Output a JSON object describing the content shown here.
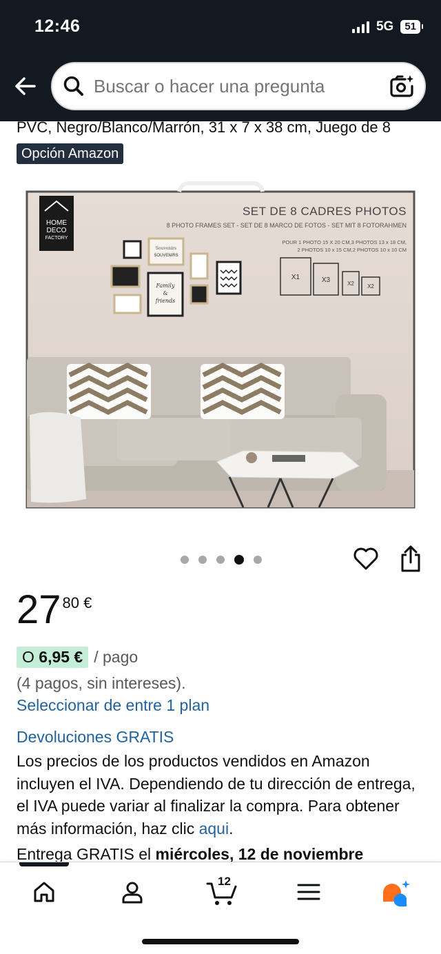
{
  "status_bar": {
    "time": "12:46",
    "network": "5G",
    "battery": "51"
  },
  "search": {
    "placeholder": "Buscar o hacer una pregunta"
  },
  "product": {
    "title_tail": "PVC, Negro/Blanco/Marrón, 31 x 7 x 38 cm, Juego de 8",
    "choice_badge": "Opción Amazon",
    "image": {
      "brand_lines": [
        "HOME",
        "DECO",
        "FACTORY"
      ],
      "headline": "SET DE 8 CADRES PHOTOS",
      "subtitle": "8 PHOTO FRAMES SET - SET DE 8 MARCO DE FOTOS - SET MIT 8 FOTORAHMEN",
      "spec_line1": "POUR 1 PHOTO 15 X 20 CM,3 PHOTOS 13 x 18 CM,",
      "spec_line2": "2 PHOTOS 10 x 15 CM,2 PHOTOS 10 x 10 CM",
      "frame_labels": [
        "X1",
        "X3",
        "X2",
        "X2"
      ],
      "frame_texts": [
        "Souvenirs",
        "SOUVENIRS",
        "Family",
        "&",
        "friends"
      ]
    },
    "carousel": {
      "count": 5,
      "active_index": 3
    },
    "price": {
      "whole": "27",
      "fraction": "80 €"
    },
    "installment": {
      "prefix": "O ",
      "amount": "6,95 €",
      "suffix": "/ pago",
      "note": "(4 pagos, sin intereses)."
    },
    "select_plan": "Seleccionar de entre 1 plan",
    "returns": "Devoluciones GRATIS",
    "vat_text": "Los precios de los productos vendidos en Amazon incluyen el IVA. Dependiendo de tu dirección de entrega, el IVA puede variar al finalizar la compra. Para obtener más información, haz clic ",
    "vat_link": "aqui",
    "vat_end": ".",
    "delivery_prefix": "Entrega GRATIS el ",
    "delivery_date": "miércoles, 12 de noviembre"
  },
  "bottom_nav": {
    "cart_count": "12",
    "items": [
      "home-icon",
      "account-icon",
      "cart-icon",
      "menu-icon",
      "rufus-icon"
    ]
  },
  "colors": {
    "header_bg": "#131921",
    "link": "#2162a1",
    "installment_bg": "#c5eed8",
    "rufus_orange": "#ff6f1b",
    "rufus_blue": "#1a8cff"
  }
}
